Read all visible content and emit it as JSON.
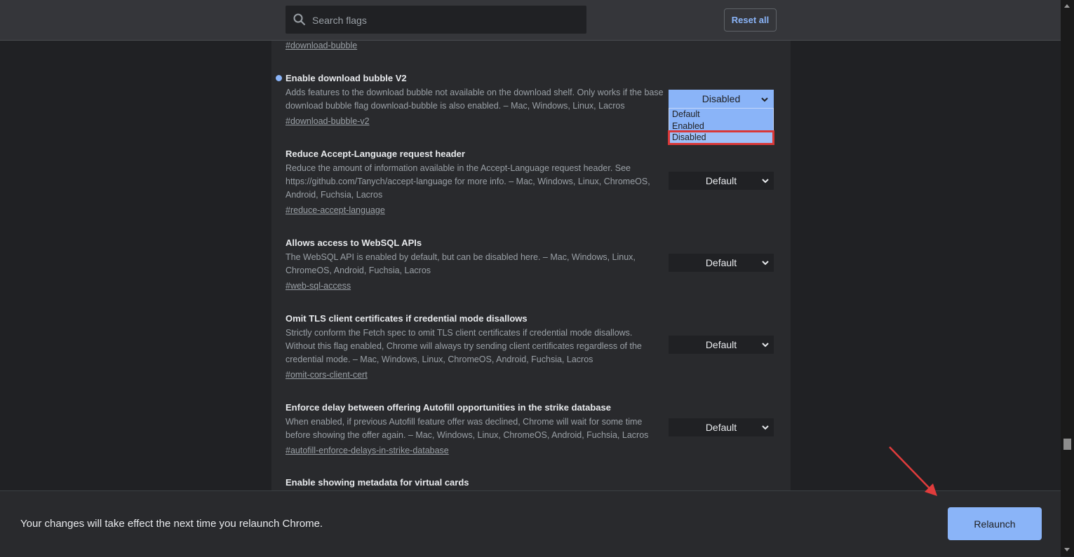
{
  "header": {
    "search_placeholder": "Search flags",
    "reset_label": "Reset all"
  },
  "top_tag": "#download-bubble",
  "flags": [
    {
      "title": "Enable download bubble V2",
      "description": "Adds features to the download bubble not available on the download shelf. Only works if the base download bubble flag download-bubble is also enabled. – Mac, Windows, Linux, Lacros",
      "tag": "#download-bubble-v2",
      "value": "Disabled",
      "modified": true
    },
    {
      "title": "Reduce Accept-Language request header",
      "description": "Reduce the amount of information available in the Accept-Language request header. See https://github.com/Tanych/accept-language for more info. – Mac, Windows, Linux, ChromeOS, Android, Fuchsia, Lacros",
      "tag": "#reduce-accept-language",
      "value": "Default"
    },
    {
      "title": "Allows access to WebSQL APIs",
      "description": "The WebSQL API is enabled by default, but can be disabled here. – Mac, Windows, Linux, ChromeOS, Android, Fuchsia, Lacros",
      "tag": "#web-sql-access",
      "value": "Default"
    },
    {
      "title": "Omit TLS client certificates if credential mode disallows",
      "description": "Strictly conform the Fetch spec to omit TLS client certificates if credential mode disallows. Without this flag enabled, Chrome will always try sending client certificates regardless of the credential mode. – Mac, Windows, Linux, ChromeOS, Android, Fuchsia, Lacros",
      "tag": "#omit-cors-client-cert",
      "value": "Default"
    },
    {
      "title": "Enforce delay between offering Autofill opportunities in the strike database",
      "description": "When enabled, if previous Autofill feature offer was declined, Chrome will wait for some time before showing the offer again. – Mac, Windows, Linux, ChromeOS, Android, Fuchsia, Lacros",
      "tag": "#autofill-enforce-delays-in-strike-database",
      "value": "Default"
    },
    {
      "title": "Enable showing metadata for virtual cards"
    }
  ],
  "dropdown": {
    "options": [
      "Default",
      "Enabled",
      "Disabled"
    ],
    "selected": "Disabled"
  },
  "footer": {
    "message": "Your changes will take effect the next time you relaunch Chrome.",
    "relaunch_label": "Relaunch"
  },
  "colors": {
    "accent": "#8ab4f8",
    "annotation": "#e03c3c"
  }
}
